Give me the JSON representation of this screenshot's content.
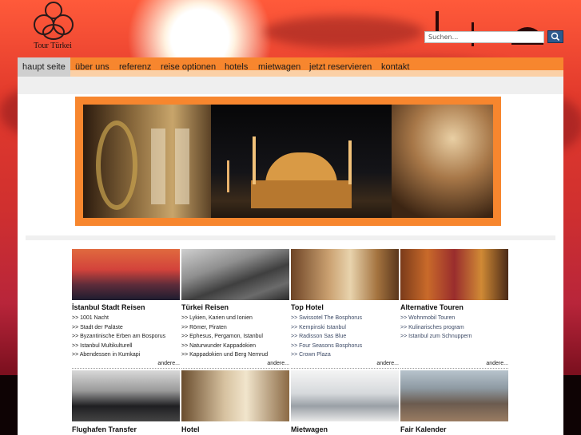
{
  "brand": {
    "name": "Tour Türkei"
  },
  "search": {
    "placeholder": "Suchen...",
    "button_icon": "search-icon"
  },
  "nav": [
    {
      "label": "haupt seite",
      "active": true
    },
    {
      "label": "über uns"
    },
    {
      "label": "referenz"
    },
    {
      "label": "reise optionen"
    },
    {
      "label": "hotels"
    },
    {
      "label": "mietwagen"
    },
    {
      "label": "jetzt reservieren"
    },
    {
      "label": "kontakt"
    }
  ],
  "tiles_row1": [
    {
      "title": "İstanbul Stadt Reisen",
      "links": [
        ">> 1001 Nacht",
        ">> Stadt der Paläste",
        ">> Byzantinische Erben am Bosporus",
        ">> Istanbul Multikulturell",
        ">> Abendessen in Kumkapi"
      ],
      "more": "andere..."
    },
    {
      "title": "Türkei Reisen",
      "links": [
        ">> Lykien, Karien und Ionien",
        ">> Römer, Piraten",
        ">> Ephesus, Pergamon, Istanbul",
        ">> Naturwunder Kappadokien",
        ">> Kappadokien und Berg Nemrud"
      ],
      "more": "andere..."
    },
    {
      "title": "Top Hotel",
      "links": [
        ">> Swissotel The Bosphorus",
        ">> Kempinski Istanbul",
        ">> Radisson Sas Blue",
        ">> Four Seasons Bosphorus",
        ">> Crown Plaza"
      ],
      "more": "andere..."
    },
    {
      "title": "Alternative Touren",
      "links": [
        ">> Wohnmobil Touren",
        ">> Kulinarisches program",
        ">> Istanbul zum Schnuppern"
      ],
      "more": "andere..."
    }
  ],
  "tiles_row2": [
    {
      "title": "Flughafen Transfer"
    },
    {
      "title": "Hotel"
    },
    {
      "title": "Mietwagen"
    },
    {
      "title": "Fair Kalender"
    }
  ],
  "colors": {
    "accent_orange": "#f7862e",
    "nav_active": "#cfcfcf",
    "search_button": "#2d5a8e"
  }
}
